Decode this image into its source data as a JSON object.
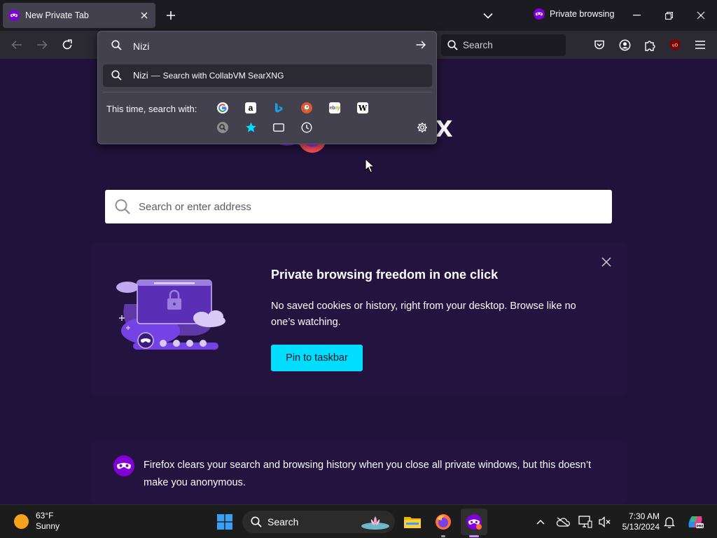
{
  "tabs": {
    "active_title": "New Private Tab",
    "private_indicator": "Private browsing"
  },
  "navbar": {
    "search_placeholder": "Search"
  },
  "urlbar": {
    "typed_text": "Nizi",
    "result_query": "Nizi",
    "result_separator": "—",
    "result_action": "Search with CollabVM SearXNG",
    "oneoff_label": "This time, search with:",
    "engines": [
      "google-icon",
      "amazon-icon",
      "bing-icon",
      "duckduckgo-icon",
      "ebay-icon",
      "wikipedia-icon",
      "searxng-icon",
      "bookmarks-icon",
      "tabs-icon",
      "history-icon"
    ]
  },
  "page": {
    "wordmark_fragment": "x",
    "search_placeholder": "Search or enter address",
    "promo": {
      "title": "Private browsing freedom in one click",
      "description": "No saved cookies or history, right from your desktop. Browse like no one’s watching.",
      "button": "Pin to taskbar"
    },
    "info_text": "Firefox clears your search and browsing history when you close all private windows, but this doesn’t make you anonymous."
  },
  "taskbar": {
    "weather_temp": "63°F",
    "weather_desc": "Sunny",
    "search_label": "Search",
    "time": "7:30 AM",
    "date": "5/13/2024"
  },
  "colors": {
    "page_bg": "#20123a",
    "card_bg": "#25133f",
    "accent_button": "#00ddff",
    "private_purple": "#8000d7",
    "toolbar": "#2b2a33",
    "tabstrip": "#1c1b22"
  }
}
